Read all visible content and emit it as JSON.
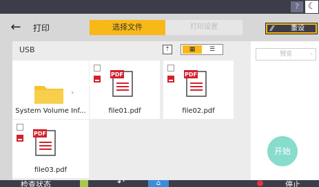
{
  "topbar": {
    "help_icon": "?",
    "moon_icon": "☾"
  },
  "header": {
    "back_icon": "←",
    "title": "打印",
    "tab_select_file": "选择文件",
    "tab_print_settings": "打印设置",
    "reset_label": "重设",
    "reset_icon": "⁄⁄"
  },
  "filepanel": {
    "path": "USB",
    "up_icon": "⇡",
    "grid_icon": "▦",
    "list_icon": "☰",
    "items": [
      {
        "name": "System Volume Inf...",
        "type": "folder"
      },
      {
        "name": "file01.pdf",
        "type": "pdf"
      },
      {
        "name": "file02.pdf",
        "type": "pdf"
      },
      {
        "name": "file03.pdf",
        "type": "pdf"
      }
    ]
  },
  "side": {
    "preview_label": "预览",
    "preview_chev": "›",
    "start_label": "开始"
  },
  "bottom": {
    "status_label": "检查状态",
    "back_icon": "↶",
    "home_icon": "⌂",
    "stop_label": "停止"
  },
  "colors": {
    "accent": "#f8b817",
    "dark": "#3c3d48",
    "start": "#87dccb",
    "pdf_red": "#d3202c"
  }
}
